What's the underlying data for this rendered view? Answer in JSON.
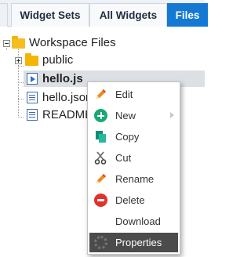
{
  "tabs": [
    {
      "label": ""
    },
    {
      "label": "Widget Sets"
    },
    {
      "label": "All Widgets"
    },
    {
      "label": "Files",
      "active": true
    }
  ],
  "tree": {
    "root": {
      "label": "Workspace Files",
      "icon": "folder-open-icon"
    },
    "items": [
      {
        "label": "public",
        "icon": "folder-icon",
        "collapsed": true
      },
      {
        "label": "hello.js",
        "icon": "js-file-icon",
        "selected": true
      },
      {
        "label": "hello.json",
        "icon": "document-file-icon"
      },
      {
        "label": "README",
        "icon": "document-file-icon"
      }
    ]
  },
  "context_menu": {
    "items": [
      {
        "label": "Edit",
        "icon": "pencil-icon"
      },
      {
        "label": "New",
        "icon": "plus-circle-icon",
        "has_submenu": true
      },
      {
        "label": "Copy",
        "icon": "copy-icon"
      },
      {
        "label": "Cut",
        "icon": "scissors-icon"
      },
      {
        "label": "Rename",
        "icon": "pencil-icon"
      },
      {
        "label": "Delete",
        "icon": "minus-circle-icon"
      },
      {
        "label": "Download",
        "icon": "download-icon"
      },
      {
        "label": "Properties",
        "icon": "gear-icon",
        "highlighted": true
      }
    ]
  },
  "colors": {
    "active_tab": "#1479d4",
    "folder": "#f4b400",
    "selected_row": "#dcdfe3",
    "menu_highlight": "#4b4b4b"
  }
}
